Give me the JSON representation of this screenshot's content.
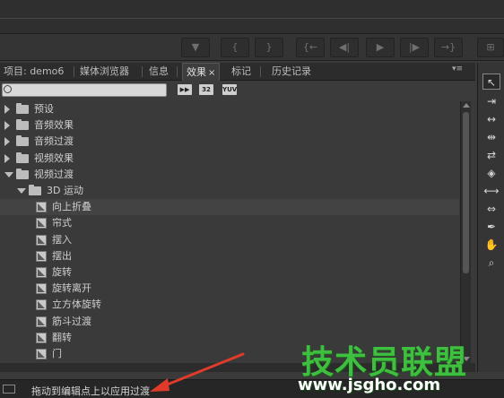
{
  "tabs": [
    {
      "label": "项目: demo6"
    },
    {
      "label": "媒体浏览器"
    },
    {
      "label": "信息"
    },
    {
      "label": "效果",
      "active": true,
      "close": "×"
    },
    {
      "label": "标记"
    },
    {
      "label": "历史记录"
    }
  ],
  "search": {
    "value": "",
    "placeholder": ""
  },
  "filters": [
    "32",
    "YUV"
  ],
  "tree": [
    {
      "label": "预设",
      "level": 0,
      "kind": "folder",
      "expanded": false
    },
    {
      "label": "音频效果",
      "level": 0,
      "kind": "folder",
      "expanded": false
    },
    {
      "label": "音频过渡",
      "level": 0,
      "kind": "folder",
      "expanded": false
    },
    {
      "label": "视频效果",
      "level": 0,
      "kind": "folder",
      "expanded": false
    },
    {
      "label": "视频过渡",
      "level": 0,
      "kind": "folder",
      "expanded": true
    },
    {
      "label": "3D 运动",
      "level": 1,
      "kind": "folder",
      "expanded": true
    },
    {
      "label": "向上折叠",
      "level": 2,
      "kind": "effect",
      "selected": true
    },
    {
      "label": "帘式",
      "level": 2,
      "kind": "effect"
    },
    {
      "label": "摆入",
      "level": 2,
      "kind": "effect"
    },
    {
      "label": "摆出",
      "level": 2,
      "kind": "effect"
    },
    {
      "label": "旋转",
      "level": 2,
      "kind": "effect"
    },
    {
      "label": "旋转离开",
      "level": 2,
      "kind": "effect"
    },
    {
      "label": "立方体旋转",
      "level": 2,
      "kind": "effect"
    },
    {
      "label": "筋斗过渡",
      "level": 2,
      "kind": "effect"
    },
    {
      "label": "翻转",
      "level": 2,
      "kind": "effect"
    },
    {
      "label": "门",
      "level": 2,
      "kind": "effect"
    }
  ],
  "status": {
    "text": "拖动到编辑点上以应用过渡"
  },
  "watermark": {
    "title": "技术员联盟",
    "url": "www.jsgho.com"
  },
  "colors": {
    "background": "#3a3a3a",
    "accent_watermark": "#3fbf3f",
    "arrow": "#e03a2a"
  }
}
